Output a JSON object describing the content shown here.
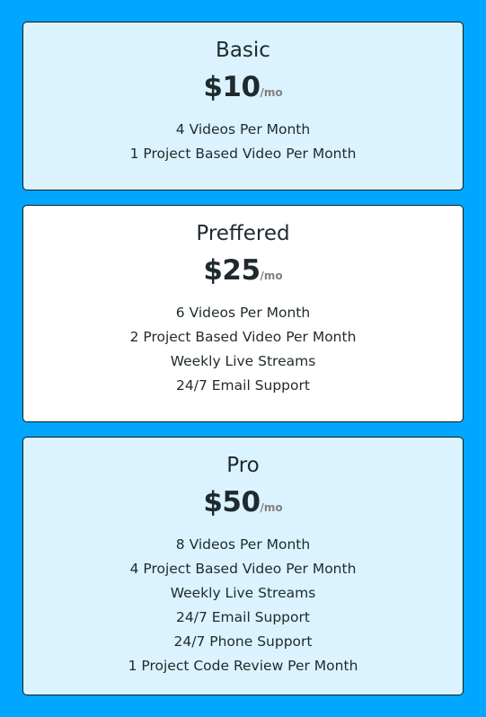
{
  "plans": [
    {
      "name": "Basic",
      "price": "$10",
      "period": "/mo",
      "features": [
        "4 Videos Per Month",
        "1 Project Based Video Per Month"
      ]
    },
    {
      "name": "Preffered",
      "price": "$25",
      "period": "/mo",
      "features": [
        "6 Videos Per Month",
        "2 Project Based Video Per Month",
        "Weekly Live Streams",
        "24/7 Email Support"
      ]
    },
    {
      "name": "Pro",
      "price": "$50",
      "period": "/mo",
      "features": [
        "8 Videos Per Month",
        "4 Project Based Video Per Month",
        "Weekly Live Streams",
        "24/7 Email Support",
        "24/7 Phone Support",
        "1 Project Code Review Per Month"
      ]
    }
  ],
  "colors": {
    "background": "#00a6ff",
    "card_tint": "#daf3fe",
    "card_plain": "#ffffff",
    "text": "#1f2a2e",
    "period_text": "#808080"
  }
}
